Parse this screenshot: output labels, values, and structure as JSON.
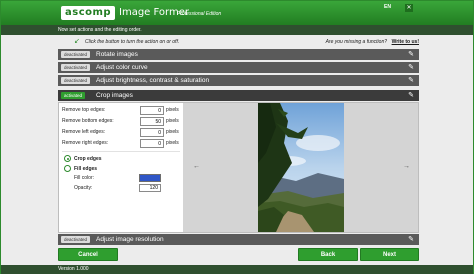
{
  "header": {
    "logo": "ascomp",
    "app_title": "Image Former",
    "edition": "Professional Edition",
    "language": "EN",
    "close_glyph": "✕"
  },
  "subheader": {
    "text": "Now set actions and the editing order."
  },
  "hint": {
    "text": "Click the button to turn the action on or off.",
    "question": "Are you missing a function?",
    "link": "Write to us!"
  },
  "steps": [
    {
      "status": "deactivated",
      "label": "Rotate images"
    },
    {
      "status": "deactivated",
      "label": "Adjust color curve"
    },
    {
      "status": "deactivated",
      "label": "Adjust brightness, contrast & saturation"
    },
    {
      "status": "activated",
      "label": "Crop images"
    },
    {
      "status": "deactivated",
      "label": "Adjust image resolution"
    }
  ],
  "crop": {
    "fields": [
      {
        "label": "Remove top edges:",
        "value": "0",
        "unit": "pixels"
      },
      {
        "label": "Remove bottom edges:",
        "value": "50",
        "unit": "pixels"
      },
      {
        "label": "Remove left edges:",
        "value": "0",
        "unit": "pixels"
      },
      {
        "label": "Remove right edges:",
        "value": "0",
        "unit": "pixels"
      }
    ],
    "options": [
      {
        "label": "Crop edges",
        "selected": true
      },
      {
        "label": "Fill edges",
        "selected": false
      }
    ],
    "fill_color_label": "Fill color:",
    "fill_color": "#2f56c7",
    "opacity_label": "Opacity:",
    "opacity_value": "120"
  },
  "preview": {
    "left_arrow": "←",
    "right_arrow": "→"
  },
  "buttons": {
    "cancel": "Cancel",
    "back": "Back",
    "next": "Next"
  },
  "status": {
    "version": "Version 1.000"
  },
  "colors": {
    "accent": "#2f9e2f",
    "header": "#2d8a2d",
    "dark": "#2f4f2f"
  }
}
